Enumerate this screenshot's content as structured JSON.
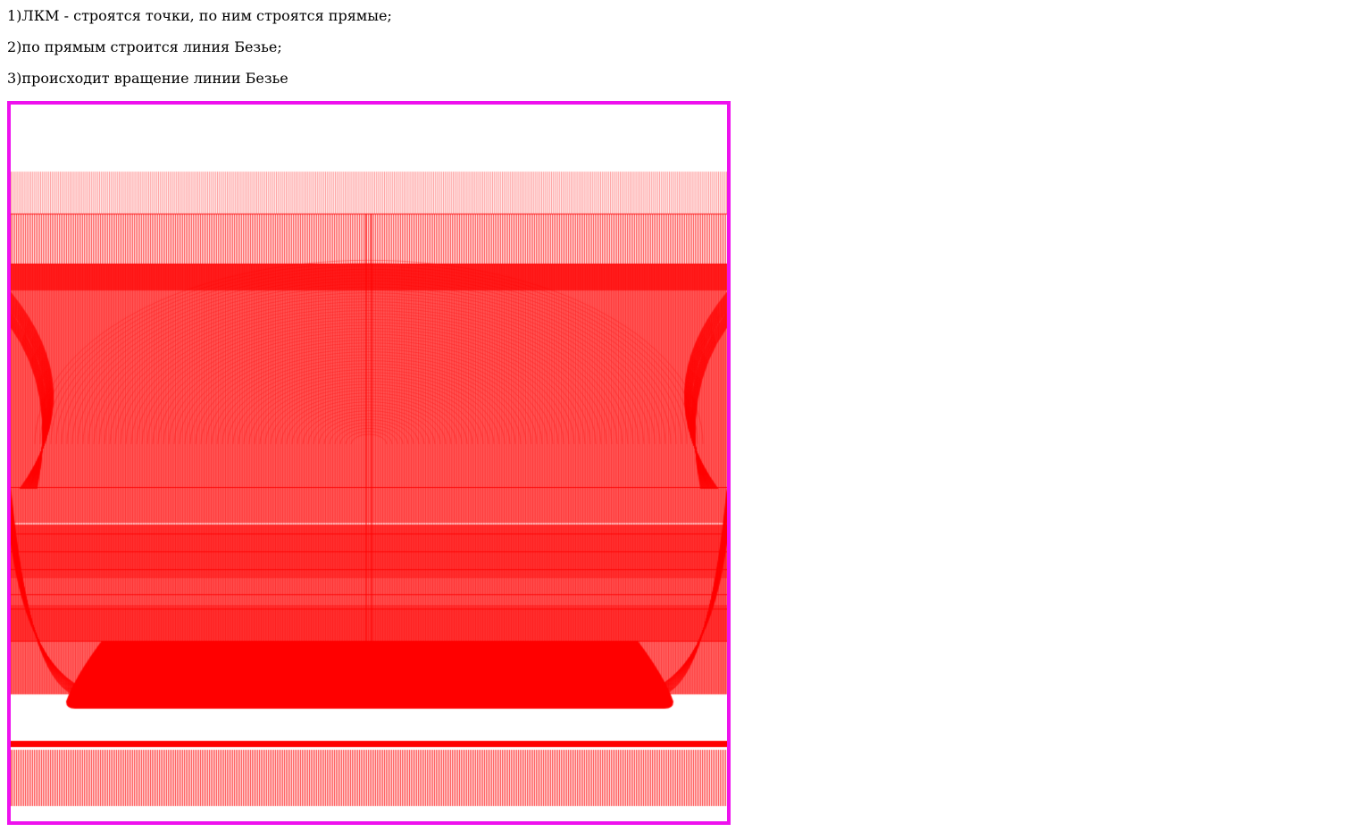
{
  "instructions": [
    "1)ЛКМ - строятся точки, по ним строятся прямые;",
    "2)по прямым строится линия Безье;",
    "3)происходит вращение линии Безье"
  ],
  "canvas": {
    "border_color": "#ee11ee",
    "stroke_color": "#ff0000",
    "background": "#ffffff"
  }
}
